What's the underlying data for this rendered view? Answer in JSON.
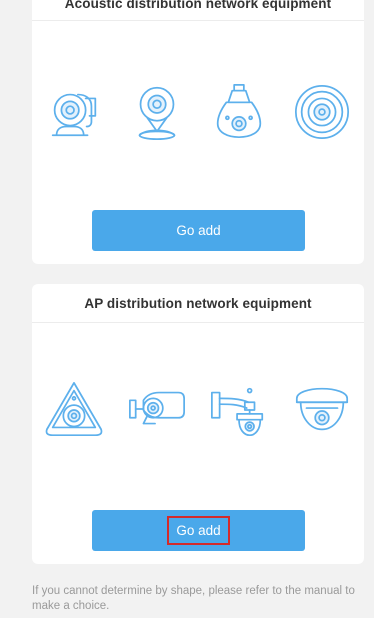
{
  "sections": [
    {
      "title": "Acoustic distribution network equipment",
      "button_label": "Go add",
      "devices": [
        "pan-tilt-camera-icon",
        "mini-camera-icon",
        "bulb-camera-icon",
        "ceiling-camera-icon"
      ]
    },
    {
      "title": "AP distribution network equipment",
      "button_label": "Go add",
      "devices": [
        "fisheye-camera-icon",
        "bullet-camera-icon",
        "ptz-dome-camera-icon",
        "dome-camera-icon"
      ]
    }
  ],
  "footer": {
    "hint": "If you cannot determine by shape, please refer to the manual to make a choice."
  },
  "colors": {
    "accent": "#4aa8ea",
    "icon": "#5db0ec",
    "highlight": "#d42a2a"
  }
}
